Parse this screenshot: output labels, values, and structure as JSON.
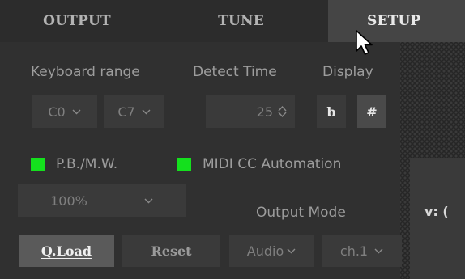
{
  "tabs": [
    {
      "label": "OUTPUT"
    },
    {
      "label": "TUNE"
    },
    {
      "label": "SETUP"
    }
  ],
  "selected_tab": "SETUP",
  "labels": {
    "keyboard_range": "Keyboard range",
    "detect_time": "Detect Time",
    "display": "Display",
    "output_mode": "Output Mode"
  },
  "keyboard_range": {
    "low": "C0",
    "high": "C7"
  },
  "detect_time": {
    "value": "25"
  },
  "display": {
    "flat": "b",
    "sharp": "#",
    "selected": "#"
  },
  "toggles": {
    "pbmw": {
      "label": "P.B./M.W.",
      "on": true,
      "color": "#14e01d"
    },
    "midi_cc": {
      "label": "MIDI CC Automation",
      "on": true,
      "color": "#14e01d"
    }
  },
  "zoom": {
    "value": "100%"
  },
  "buttons": {
    "qload": "Q.Load",
    "reset": "Reset"
  },
  "output_mode": {
    "type": "Audio",
    "channel": "ch.1"
  },
  "side": {
    "v_label": "v: ("
  }
}
